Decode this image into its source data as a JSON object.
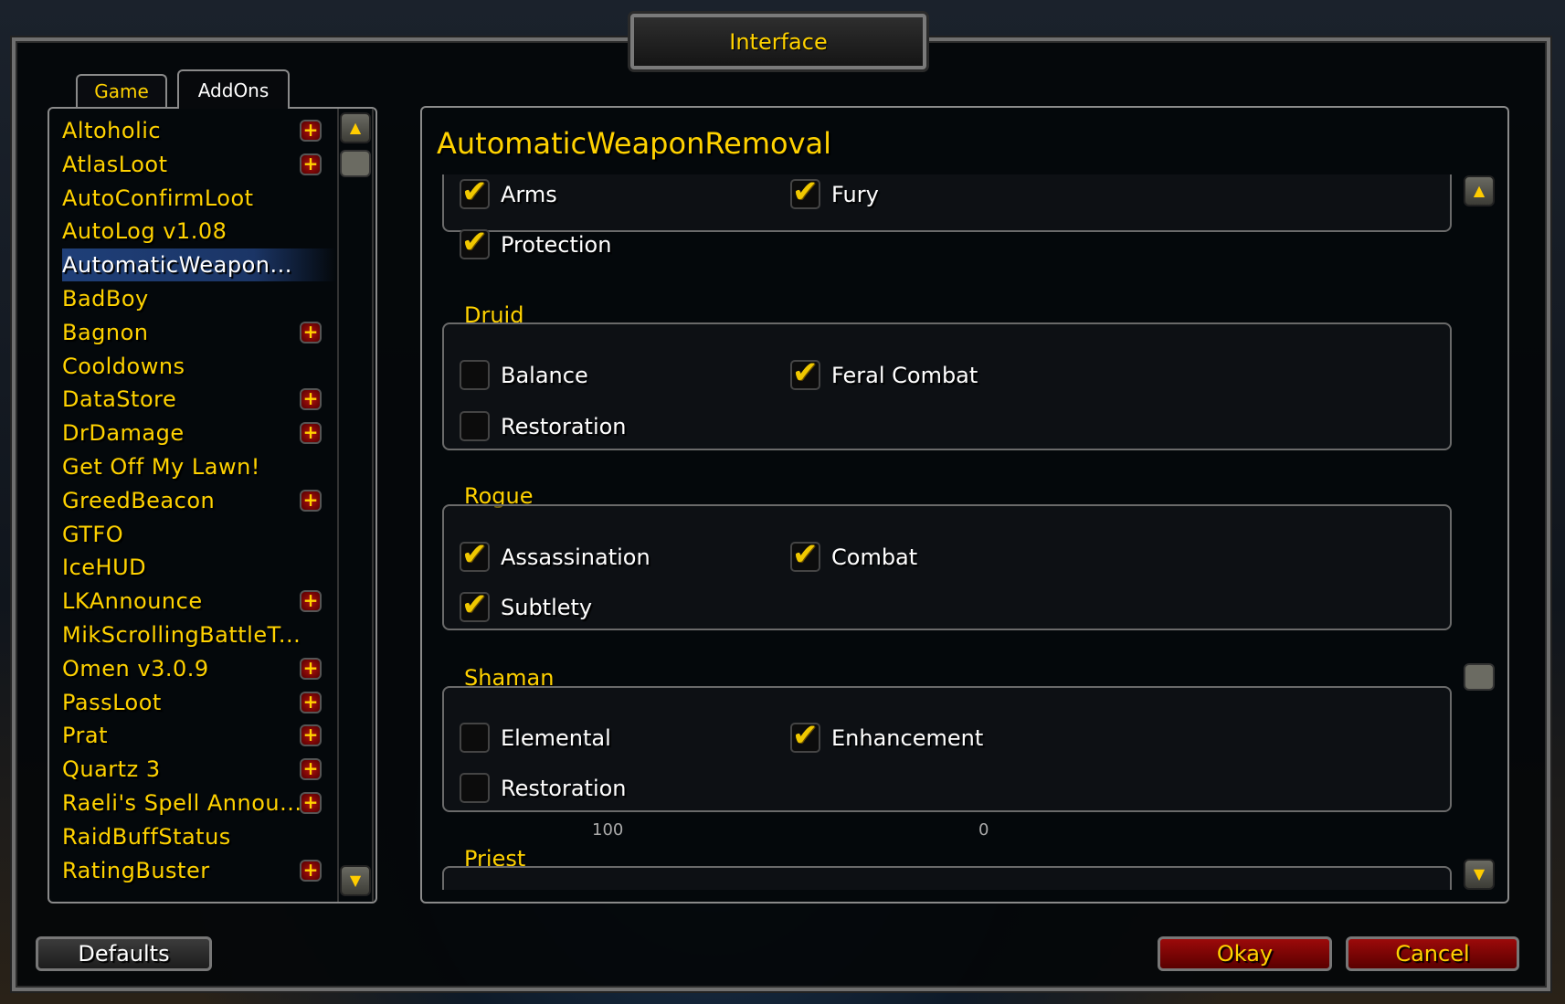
{
  "window": {
    "title": "Interface"
  },
  "tabs": [
    {
      "label": "Game",
      "active": false
    },
    {
      "label": "AddOns",
      "active": true
    }
  ],
  "addons": [
    {
      "name": "Altoholic",
      "expandable": true
    },
    {
      "name": "AtlasLoot",
      "expandable": true
    },
    {
      "name": "AutoConfirmLoot",
      "expandable": false
    },
    {
      "name": "AutoLog v1.08",
      "expandable": false
    },
    {
      "name": "AutomaticWeapon...",
      "expandable": false,
      "selected": true
    },
    {
      "name": "BadBoy",
      "expandable": false
    },
    {
      "name": "Bagnon",
      "expandable": true
    },
    {
      "name": "Cooldowns",
      "expandable": false
    },
    {
      "name": "DataStore",
      "expandable": true
    },
    {
      "name": "DrDamage",
      "expandable": true
    },
    {
      "name": "Get Off My Lawn!",
      "expandable": false
    },
    {
      "name": "GreedBeacon",
      "expandable": true
    },
    {
      "name": "GTFO",
      "expandable": false
    },
    {
      "name": "IceHUD",
      "expandable": false
    },
    {
      "name": "LKAnnounce",
      "expandable": true
    },
    {
      "name": "MikScrollingBattleT...",
      "expandable": false
    },
    {
      "name": "Omen v3.0.9",
      "expandable": true
    },
    {
      "name": "PassLoot",
      "expandable": true
    },
    {
      "name": "Prat",
      "expandable": true
    },
    {
      "name": "Quartz 3",
      "expandable": true
    },
    {
      "name": "Raeli's Spell Annou...",
      "expandable": true
    },
    {
      "name": "RaidBuffStatus",
      "expandable": false
    },
    {
      "name": "RatingBuster",
      "expandable": true
    }
  ],
  "panel": {
    "title": "AutomaticWeaponRemoval",
    "groups": [
      {
        "label": "",
        "options": [
          {
            "label": "Arms",
            "checked": true
          },
          {
            "label": "Fury",
            "checked": true
          },
          {
            "label": "Protection",
            "checked": true
          }
        ]
      },
      {
        "label": "Druid",
        "options": [
          {
            "label": "Balance",
            "checked": false
          },
          {
            "label": "Feral Combat",
            "checked": true
          },
          {
            "label": "Restoration",
            "checked": false
          }
        ]
      },
      {
        "label": "Rogue",
        "options": [
          {
            "label": "Assassination",
            "checked": true
          },
          {
            "label": "Combat",
            "checked": true
          },
          {
            "label": "Subtlety",
            "checked": true
          }
        ]
      },
      {
        "label": "Shaman",
        "options": [
          {
            "label": "Elemental",
            "checked": false
          },
          {
            "label": "Enhancement",
            "checked": true
          },
          {
            "label": "Restoration",
            "checked": false
          }
        ]
      },
      {
        "label": "Priest",
        "options": []
      }
    ],
    "overlay_numbers": [
      "100",
      "0"
    ]
  },
  "buttons": {
    "defaults": "Defaults",
    "okay": "Okay",
    "cancel": "Cancel"
  },
  "colors": {
    "accent": "#ffd200",
    "selected": "#1f3f78",
    "button_red": "#8a0000"
  }
}
